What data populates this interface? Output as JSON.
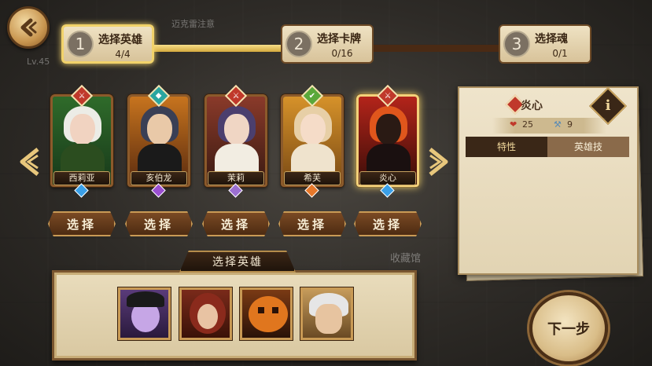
{
  "background_text": {
    "player_label": "迈克雷注意",
    "level": "Lv.45",
    "library": "收藏馆"
  },
  "steps": [
    {
      "number": "1",
      "label": "选择英雄",
      "count": "4/4"
    },
    {
      "number": "2",
      "label": "选择卡牌",
      "count": "0/16"
    },
    {
      "number": "3",
      "label": "选择魂",
      "count": "0/1"
    }
  ],
  "heroes": [
    {
      "name": "西莉亚",
      "badge_color": "#c0392b",
      "badge_icon": "sword-icon",
      "gem_color": "#3aa0e8"
    },
    {
      "name": "亥伯龙",
      "badge_color": "#2aa6a0",
      "badge_icon": "crystal-icon",
      "gem_color": "#9b4fd1"
    },
    {
      "name": "茉莉",
      "badge_color": "#c0392b",
      "badge_icon": "sword-icon",
      "gem_color": "#9b6fd1"
    },
    {
      "name": "希芙",
      "badge_color": "#5aa83a",
      "badge_icon": "leaf-icon",
      "gem_color": "#e8782a"
    },
    {
      "name": "炎心",
      "badge_color": "#c0392b",
      "badge_icon": "sword-icon",
      "gem_color": "#3aa0e8"
    }
  ],
  "select_button_label": "选择",
  "detail": {
    "hero_name": "炎心",
    "hp": "25",
    "attack": "9",
    "tabs": [
      "特性",
      "英雄技"
    ],
    "info_icon": "i"
  },
  "selected_strip": {
    "title": "选择英雄"
  },
  "next_button_label": "下一步"
}
